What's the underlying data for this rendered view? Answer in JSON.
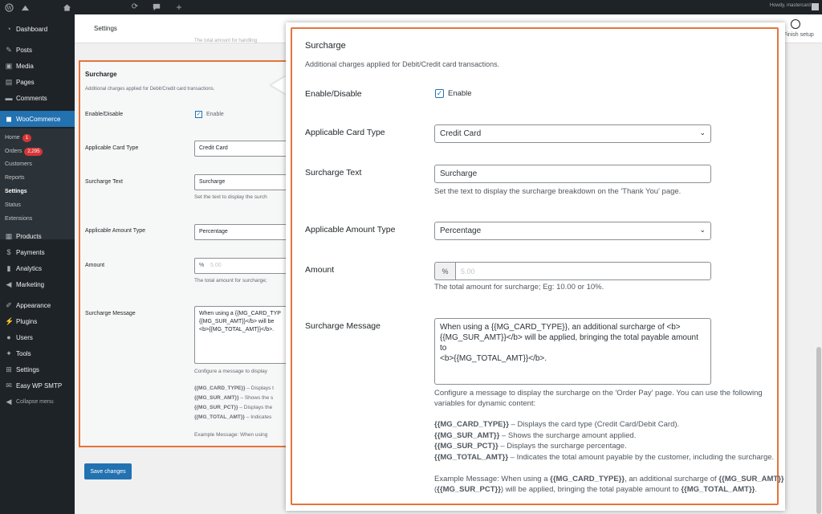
{
  "adminbar": {
    "howdy": "Howdy, mastercard"
  },
  "sidebar": {
    "items": [
      {
        "label": "Dashboard",
        "icon": "dashboard-icon"
      },
      {
        "label": "Posts",
        "icon": "pin-icon"
      },
      {
        "label": "Media",
        "icon": "media-icon"
      },
      {
        "label": "Pages",
        "icon": "pages-icon"
      },
      {
        "label": "Comments",
        "icon": "comments-icon"
      },
      {
        "label": "WooCommerce",
        "icon": "woo-icon"
      },
      {
        "label": "Products",
        "icon": "products-icon"
      },
      {
        "label": "Payments",
        "icon": "payments-icon"
      },
      {
        "label": "Analytics",
        "icon": "analytics-icon"
      },
      {
        "label": "Marketing",
        "icon": "marketing-icon"
      },
      {
        "label": "Appearance",
        "icon": "brush-icon"
      },
      {
        "label": "Plugins",
        "icon": "plugin-icon"
      },
      {
        "label": "Users",
        "icon": "users-icon"
      },
      {
        "label": "Tools",
        "icon": "tools-icon"
      },
      {
        "label": "Settings",
        "icon": "settings-icon"
      },
      {
        "label": "Easy WP SMTP",
        "icon": "mail-icon"
      },
      {
        "label": "Collapse menu",
        "icon": "collapse-icon"
      }
    ],
    "submenu": [
      {
        "label": "Home",
        "badge": "1"
      },
      {
        "label": "Orders",
        "badge": "2,295"
      },
      {
        "label": "Customers"
      },
      {
        "label": "Reports"
      },
      {
        "label": "Settings"
      },
      {
        "label": "Status"
      },
      {
        "label": "Extensions"
      }
    ]
  },
  "header": {
    "title": "Settings",
    "finish_setup": "Finish setup"
  },
  "background": {
    "faded_text": "The total amount for handling",
    "section_title": "Surcharge",
    "section_desc": "Additional charges applied for Debit/Credit card transactions.",
    "enable_label": "Enable/Disable",
    "enable_text": "Enable",
    "card_type_label": "Applicable Card Type",
    "card_type_value": "Credit Card",
    "surcharge_text_label": "Surcharge Text",
    "surcharge_text_value": "Surcharge",
    "surcharge_text_help": "Set the text to display the surch",
    "amount_type_label": "Applicable Amount Type",
    "amount_type_value": "Percentage",
    "amount_label": "Amount",
    "amount_prefix": "%",
    "amount_placeholder": "5.00",
    "amount_help": "The total amount for surcharge;",
    "message_label": "Surcharge Message",
    "message_line1": "When using a {{MG_CARD_TYP",
    "message_line2": "{{MG_SUR_AMT}}</b> will be",
    "message_line3": "<b>{{MG_TOTAL_AMT}}</b>.",
    "message_help": "Configure a message to display",
    "var1_key": "{{MG_CARD_TYPE}}",
    "var1_text": " – Displays t",
    "var2_key": "{{MG_SUR_AMT}}",
    "var2_text": " – Shows the s",
    "var3_key": "{{MG_SUR_PCT}}",
    "var3_text": " – Displays the",
    "var4_key": "{{MG_TOTAL_AMT}}",
    "var4_text": " – Indicates",
    "example": "Example Message: When using",
    "save_button": "Save changes"
  },
  "callout": {
    "section_title": "Surcharge",
    "section_desc": "Additional charges applied for Debit/Credit card transactions.",
    "enable_label": "Enable/Disable",
    "enable_text": "Enable",
    "card_type_label": "Applicable Card Type",
    "card_type_value": "Credit Card",
    "surcharge_text_label": "Surcharge Text",
    "surcharge_text_value": "Surcharge",
    "surcharge_text_help": "Set the text to display the surcharge breakdown on the 'Thank You' page.",
    "amount_type_label": "Applicable Amount Type",
    "amount_type_value": "Percentage",
    "amount_label": "Amount",
    "amount_prefix": "%",
    "amount_placeholder": "5.00",
    "amount_help": "The total amount for surcharge; Eg: 10.00 or 10%.",
    "message_label": "Surcharge Message",
    "message_line1": "When using a {{MG_CARD_TYPE}}, an additional surcharge of <b>",
    "message_line2": "{{MG_SUR_AMT}}</b> will be applied, bringing the total payable amount to",
    "message_line3": "<b>{{MG_TOTAL_AMT}}</b>.",
    "message_help1": "Configure a message to display the surcharge on the 'Order Pay' page. You can use the following",
    "message_help2": "variables for dynamic content:",
    "var1_key": "{{MG_CARD_TYPE}}",
    "var1_text": " – Displays the card type (Credit Card/Debit Card).",
    "var2_key": "{{MG_SUR_AMT}}",
    "var2_text": " – Shows the surcharge amount applied.",
    "var3_key": "{{MG_SUR_PCT}}",
    "var3_text": " – Displays the surcharge percentage.",
    "var4_key": "{{MG_TOTAL_AMT}}",
    "var4_text": " – Indicates the total amount payable by the customer, including the surcharge.",
    "example_line1_pre": "Example Message: When using a ",
    "example_line1_key1": "{{MG_CARD_TYPE}}",
    "example_line1_mid": ", an additional surcharge of ",
    "example_line1_key2": "{{MG_SUR_AMT}}",
    "example_line2_pre": "(",
    "example_line2_key1": "{{MG_SUR_PCT}}",
    "example_line2_mid": ") will be applied, bringing the total payable amount to ",
    "example_line2_key2": "{{MG_TOTAL_AMT}}",
    "example_line2_end": "."
  },
  "colors": {
    "accent": "#2271b1",
    "highlight_border": "#e5743a",
    "sidebar_bg": "#1d2327",
    "badge": "#d63638"
  }
}
